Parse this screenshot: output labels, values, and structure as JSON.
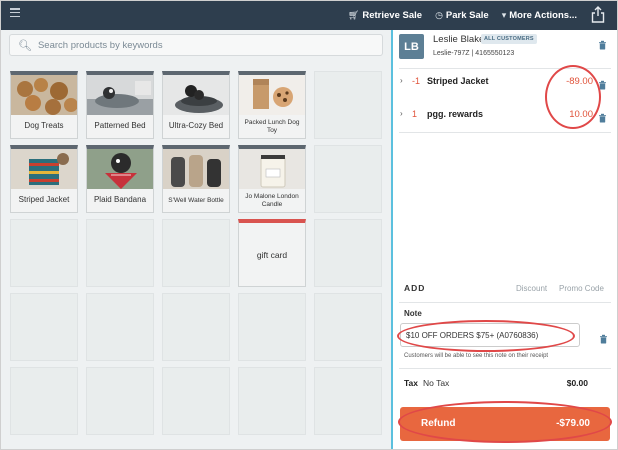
{
  "topbar": {
    "actions": [
      {
        "label": "Retrieve Sale",
        "icon": "cart-icon"
      },
      {
        "label": "Park Sale",
        "icon": "clock-icon"
      },
      {
        "label": "More Actions...",
        "icon": "caret-down-icon"
      }
    ]
  },
  "search": {
    "placeholder": "Search products by keywords"
  },
  "products": [
    {
      "label": "Dog Treats"
    },
    {
      "label": "Patterned Bed"
    },
    {
      "label": "Ultra-Cozy Bed"
    },
    {
      "label": "Packed Lunch Dog Toy"
    },
    {
      "label": "Striped Jacket"
    },
    {
      "label": "Plaid Bandana"
    },
    {
      "label": "S'Well Water Bottle"
    },
    {
      "label": "Jo Malone London Candle"
    },
    {
      "label": "gift card"
    }
  ],
  "customer": {
    "initials": "LB",
    "name": "Leslie Blake",
    "badge": "ALL CUSTOMERS",
    "id": "Leslie-797Z | 4165550123"
  },
  "cart": {
    "items": [
      {
        "qty": "-1",
        "name": "Striped Jacket",
        "price": "-89.00"
      },
      {
        "qty": "1",
        "name": "pgg. rewards",
        "price": "10.00"
      }
    ],
    "add_label": "ADD",
    "discount_label": "Discount",
    "promo_label": "Promo Code",
    "note_label": "Note",
    "note_value": "$10 OFF ORDERS $75+ (A0760836)",
    "note_hint": "Customers will be able to see this note on their receipt",
    "tax_label": "Tax",
    "tax_value": "No Tax",
    "tax_amount": "$0.00",
    "refund_label": "Refund",
    "refund_amount": "-$79.00"
  },
  "colors": {
    "topbar": "#2e3e4e",
    "accent": "#5bc0de",
    "refund": "#e8673f",
    "negative": "#e0533a",
    "annotation": "#e04848"
  }
}
